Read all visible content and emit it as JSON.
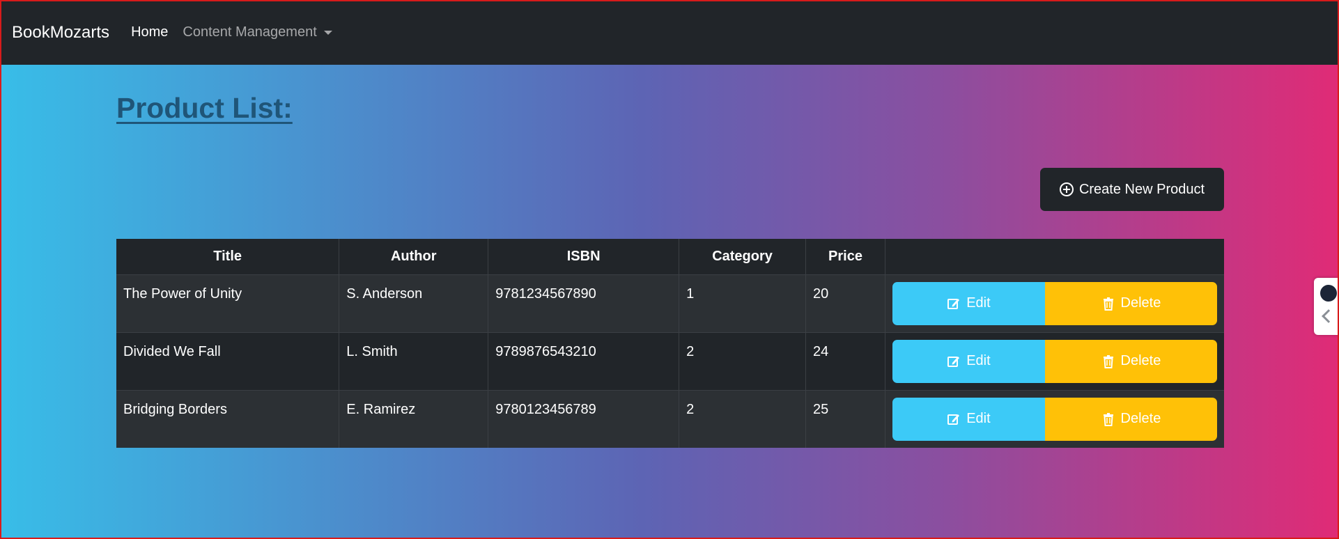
{
  "navbar": {
    "brand": "BookMozarts",
    "links": [
      {
        "label": "Home"
      },
      {
        "label": "Content Management"
      }
    ]
  },
  "page": {
    "title": "Product List:",
    "create_button_label": "Create New Product"
  },
  "table": {
    "headers": [
      "Title",
      "Author",
      "ISBN",
      "Category",
      "Price",
      ""
    ],
    "rows": [
      {
        "title": "The Power of Unity",
        "author": "S. Anderson",
        "isbn": "9781234567890",
        "category": "1",
        "price": "20"
      },
      {
        "title": "Divided We Fall",
        "author": "L. Smith",
        "isbn": "9789876543210",
        "category": "2",
        "price": "24"
      },
      {
        "title": "Bridging Borders",
        "author": "E. Ramirez",
        "isbn": "9780123456789",
        "category": "2",
        "price": "25"
      }
    ],
    "edit_label": "Edit",
    "delete_label": "Delete"
  },
  "icons": {
    "create": "plus-circle-icon",
    "edit": "pencil-square-icon",
    "delete": "trash-icon",
    "dropdown": "caret-down-icon",
    "side_toggle": "chevron-left-icon"
  },
  "colors": {
    "navbar": "#212529",
    "edit_button": "#3ccaf7",
    "delete_button": "#ffc107",
    "title": "#1f5578"
  }
}
